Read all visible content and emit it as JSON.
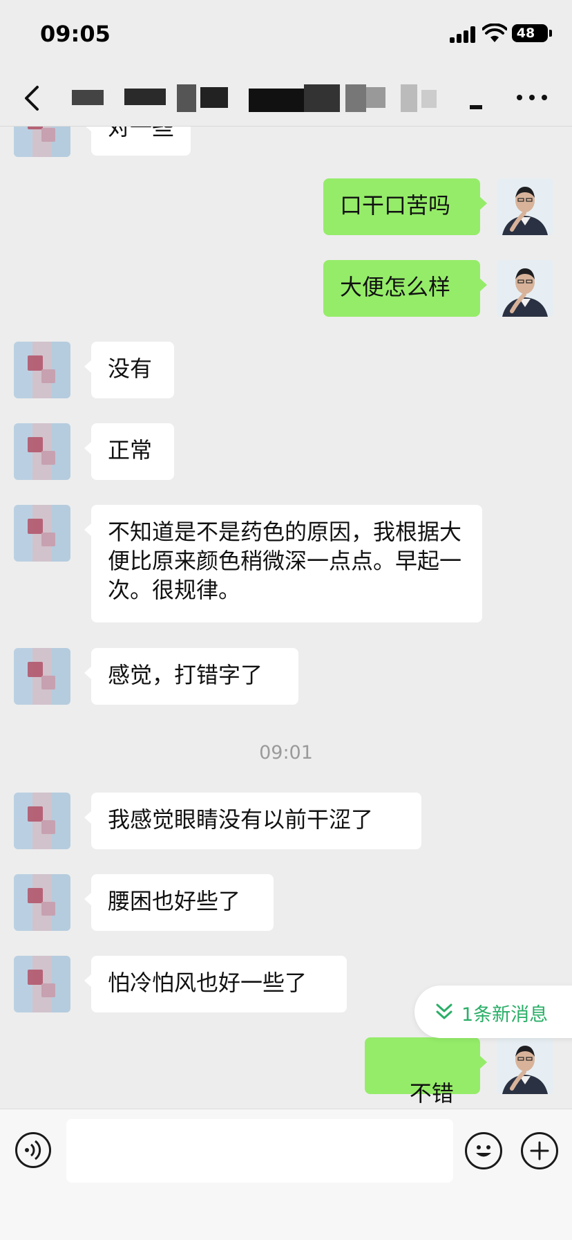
{
  "status_bar": {
    "time": "09:05",
    "battery": "48"
  },
  "nav": {
    "contact_name": ""
  },
  "messages": [
    {
      "side": "in",
      "text": "对一些"
    },
    {
      "side": "out",
      "text": "口干口苦吗"
    },
    {
      "side": "out",
      "text": "大便怎么样"
    },
    {
      "side": "in",
      "text": "没有"
    },
    {
      "side": "in",
      "text": "正常"
    },
    {
      "side": "in",
      "text": "不知道是不是药色的原因，我根据大便比原来颜色稍微深一点点。早起一次。很规律。"
    },
    {
      "side": "in",
      "text": "感觉，打错字了"
    },
    {
      "side": "divider",
      "text": "09:01"
    },
    {
      "side": "in",
      "text": "我感觉眼睛没有以前干涩了"
    },
    {
      "side": "in",
      "text": "腰困也好些了"
    },
    {
      "side": "in",
      "text": "怕冷怕风也好一些了"
    },
    {
      "side": "out",
      "text": "不错",
      "emoji": "👍"
    }
  ],
  "new_messages_pill": "1条新消息",
  "icons": {
    "back": "chevron-left-icon",
    "more": "more-dots-icon",
    "voice": "voice-icon",
    "emoji": "emoji-icon",
    "plus": "plus-icon",
    "new_message": "double-chevron-down-icon"
  },
  "colors": {
    "background": "#ededed",
    "incoming_bubble": "#ffffff",
    "outgoing_bubble": "#95ec69",
    "accent": "#2aae67"
  }
}
